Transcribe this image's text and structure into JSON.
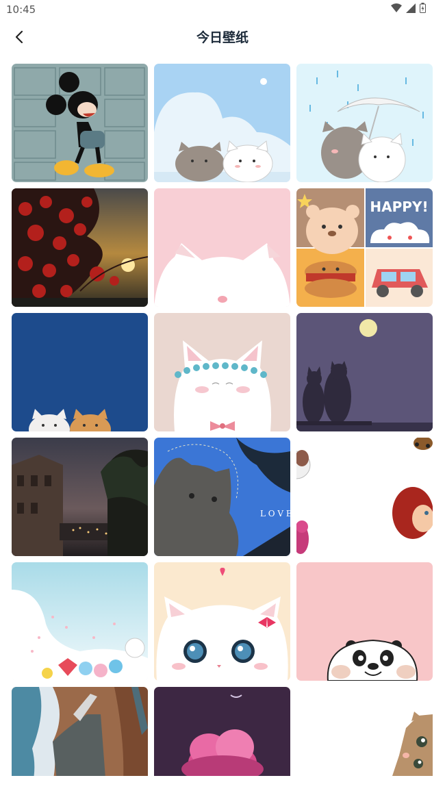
{
  "status_bar": {
    "time": "10:45"
  },
  "header": {
    "title": "今日壁纸"
  },
  "wallpapers": [
    {
      "name": "mickey-comic"
    },
    {
      "name": "cats-sky"
    },
    {
      "name": "cats-umbrella"
    },
    {
      "name": "red-flowers-sunset"
    },
    {
      "name": "pink-cat"
    },
    {
      "name": "cute-happy-collage",
      "text": "HAPPY!"
    },
    {
      "name": "blue-cats"
    },
    {
      "name": "cat-flower-crown"
    },
    {
      "name": "purple-moon-cats"
    },
    {
      "name": "city-night"
    },
    {
      "name": "cat-blue-love",
      "text": "L O V E"
    },
    {
      "name": "toy-story"
    },
    {
      "name": "bt21-sky"
    },
    {
      "name": "kitten-heart"
    },
    {
      "name": "pink-panda"
    },
    {
      "name": "coast-aerial"
    },
    {
      "name": "pink-cloud-night"
    },
    {
      "name": "peeking-cat"
    }
  ]
}
